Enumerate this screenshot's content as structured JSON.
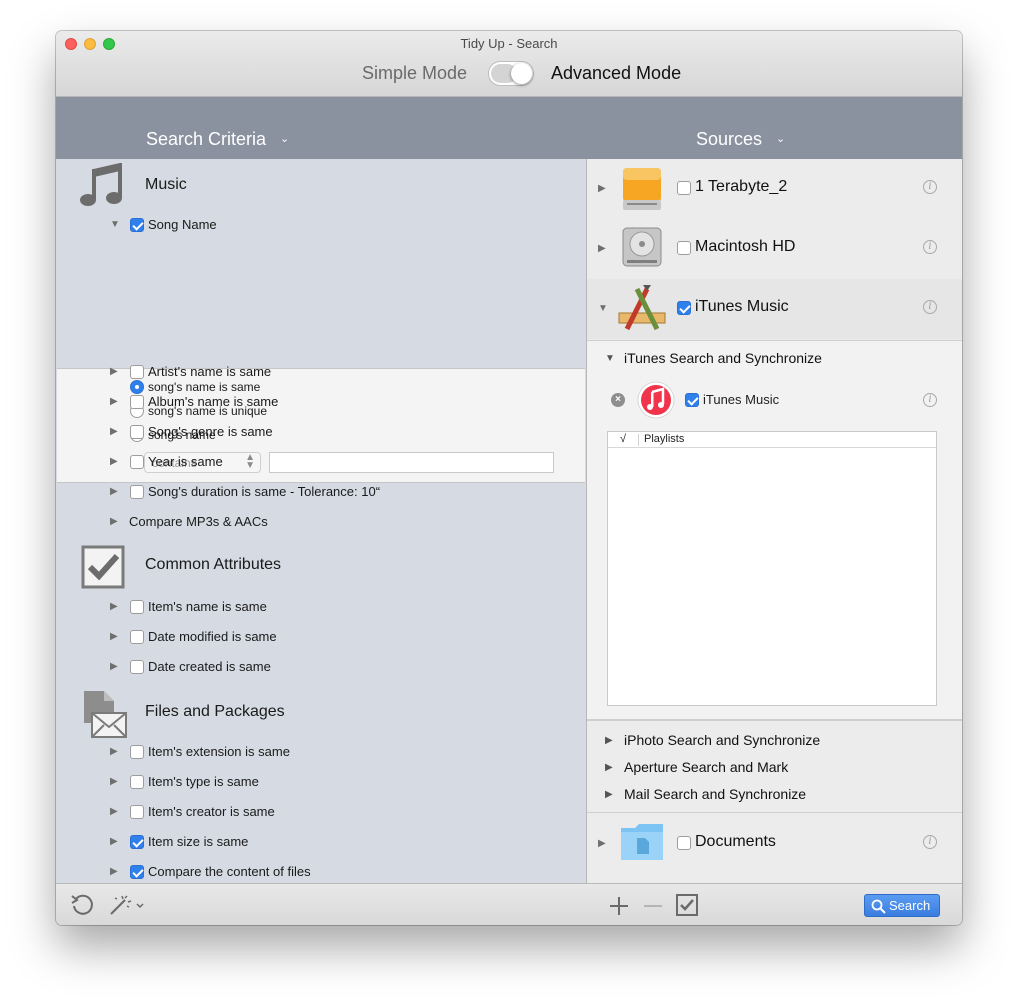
{
  "window": {
    "title": "Tidy Up - Search"
  },
  "mode": {
    "simple_label": "Simple Mode",
    "advanced_label": "Advanced Mode",
    "advanced_on": true
  },
  "headers": {
    "criteria": "Search Criteria",
    "sources": "Sources"
  },
  "criteria": {
    "music": {
      "title": "Music",
      "song_name": "Song Name",
      "options": {
        "same": "song's name is same",
        "unique": "song's name is unique",
        "name": "song's name",
        "select_value": "contains",
        "text_value": ""
      },
      "items": [
        "Artist's name is same",
        "Album's name is same",
        "Song's genre is same",
        "Year is same",
        "Song's duration is same - Tolerance: 10“"
      ],
      "compare": "Compare MP3s & AACs"
    },
    "common": {
      "title": "Common Attributes",
      "items": [
        "Item's name is same",
        "Date modified is same",
        "Date created is same"
      ]
    },
    "files": {
      "title": "Files and Packages",
      "items": [
        "Item's extension is same",
        "Item's type is same",
        "Item's creator is same",
        "Item size is same",
        "Compare the content of files"
      ]
    }
  },
  "sources": {
    "drives": [
      {
        "label": "1 Terabyte_2",
        "icon": "external-drive-icon",
        "checked": false
      },
      {
        "label": "Macintosh HD",
        "icon": "internal-drive-icon",
        "checked": false
      },
      {
        "label": "iTunes Music",
        "icon": "app-icon",
        "checked": true
      }
    ],
    "itunes_sync": {
      "label": "iTunes Search and Synchronize",
      "library_label": "iTunes Music",
      "playlist_check": "√",
      "playlist_header": "Playlists"
    },
    "subsections": [
      "iPhoto Search and Synchronize",
      "Aperture Search and Mark",
      "Mail Search and Synchronize"
    ],
    "documents": {
      "label": "Documents",
      "checked": false
    }
  },
  "toolbar": {
    "search_label": "Search"
  },
  "colors": {
    "accent": "#2f80ed",
    "header": "#8a92a0",
    "left_pane": "#d6dbe3"
  }
}
